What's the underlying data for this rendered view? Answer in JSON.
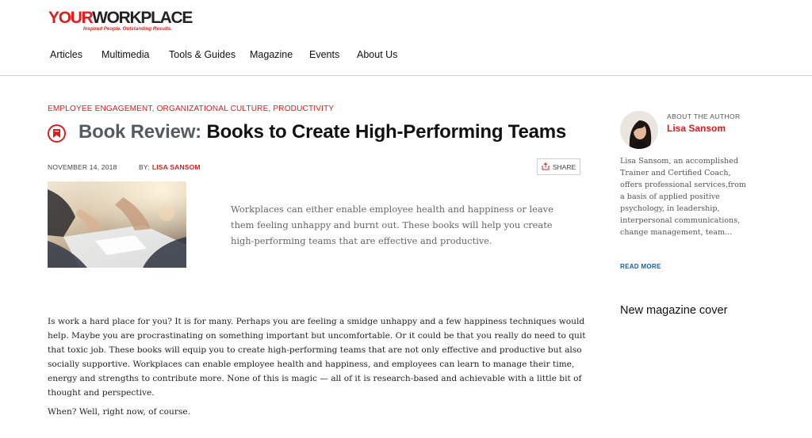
{
  "site": {
    "logo_part1": "YOUR",
    "logo_part2": "WORKPLACE",
    "tagline": "Inspired People. Outstanding Results."
  },
  "nav": {
    "items": [
      "Articles",
      "Multimedia",
      "Tools & Guides",
      "Magazine",
      "Events",
      "About Us"
    ]
  },
  "article": {
    "categories": "EMPLOYEE ENGAGEMENT, ORGANIZATIONAL CULTURE, PRODUCTIVITY",
    "title_prefix": "Book Review:",
    "title_main": "Books to Create High-Performing Teams",
    "date": "NOVEMBER 14, 2018",
    "by_label": "BY:",
    "author": "LISA SANSOM",
    "share_label": "SHARE",
    "excerpt": "Workplaces can either enable employee health and happiness or leave them feeling unhappy and burnt out. These books will help you create high-performing teams that are effective and productive.",
    "body_p1": "Is work a hard place for you? It is for many. Perhaps you are feeling a smidge unhappy and a few happiness techniques would help. Maybe you are procrastinating on something important but uncomfortable. Or it could be that you really do need to quit that toxic job. These books will equip you to create high-performing teams that are not only effective and productive but also socially supportive. Workplaces can enable employee health and happiness, and employees can learn to manage their time, energy and strengths to contribute more. None of this is magic — all of it is research-based and achievable with a little bit of thought and perspective.",
    "body_p2": "When? Well, right now, of course."
  },
  "sidebar": {
    "about_label": "ABOUT THE AUTHOR",
    "author_name": "Lisa Sansom",
    "bio": "Lisa Sansom, an accomplished Trainer and Certified Coach, offers professional services,from a basis of applied positive psychology, in leadership, interpersonal communications, change management, team...",
    "read_more": "READ MORE",
    "magazine_heading": "New magazine cover"
  },
  "icons": {
    "title_icon": "bookmark-icon",
    "share_icon": "share-icon"
  },
  "colors": {
    "accent": "#d42020",
    "link": "#1a5aa8",
    "title_prefix": "#555b63"
  }
}
